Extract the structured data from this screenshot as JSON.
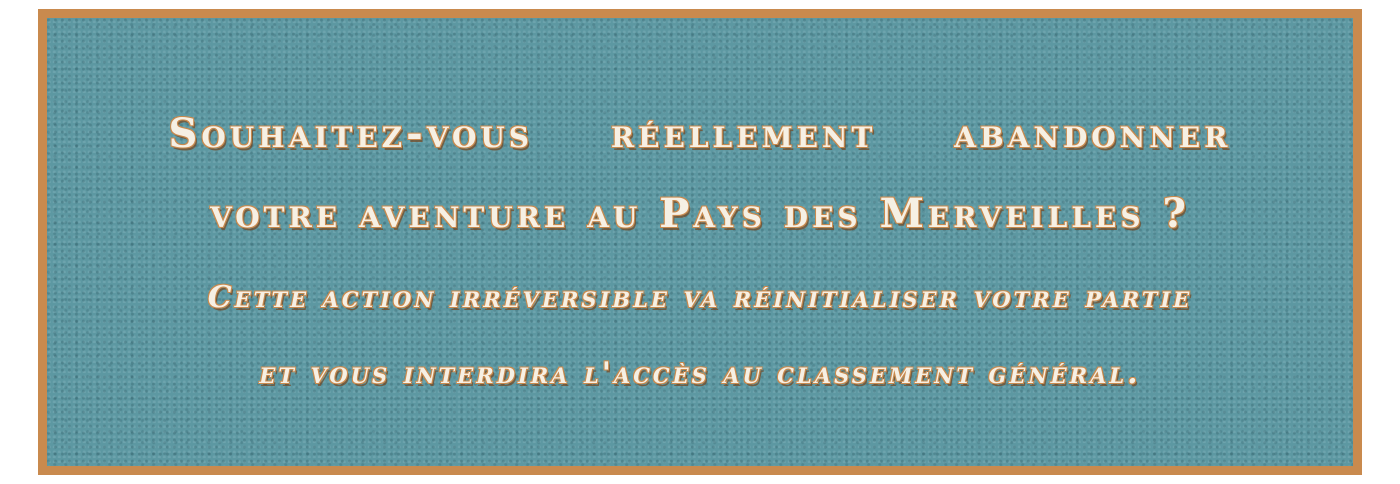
{
  "dialog": {
    "question_line1": "Souhaitez-vous réellement abandonner",
    "question_line2": "votre aventure au Pays des Merveilles ?",
    "warning_line1": "Cette action irréversible va réinitialiser votre partie",
    "warning_line2": "et vous interdira l'accès au classement général."
  },
  "colors": {
    "panel": "#5d98a2",
    "border": "#c98a4e",
    "text": "#f6f0e4"
  }
}
